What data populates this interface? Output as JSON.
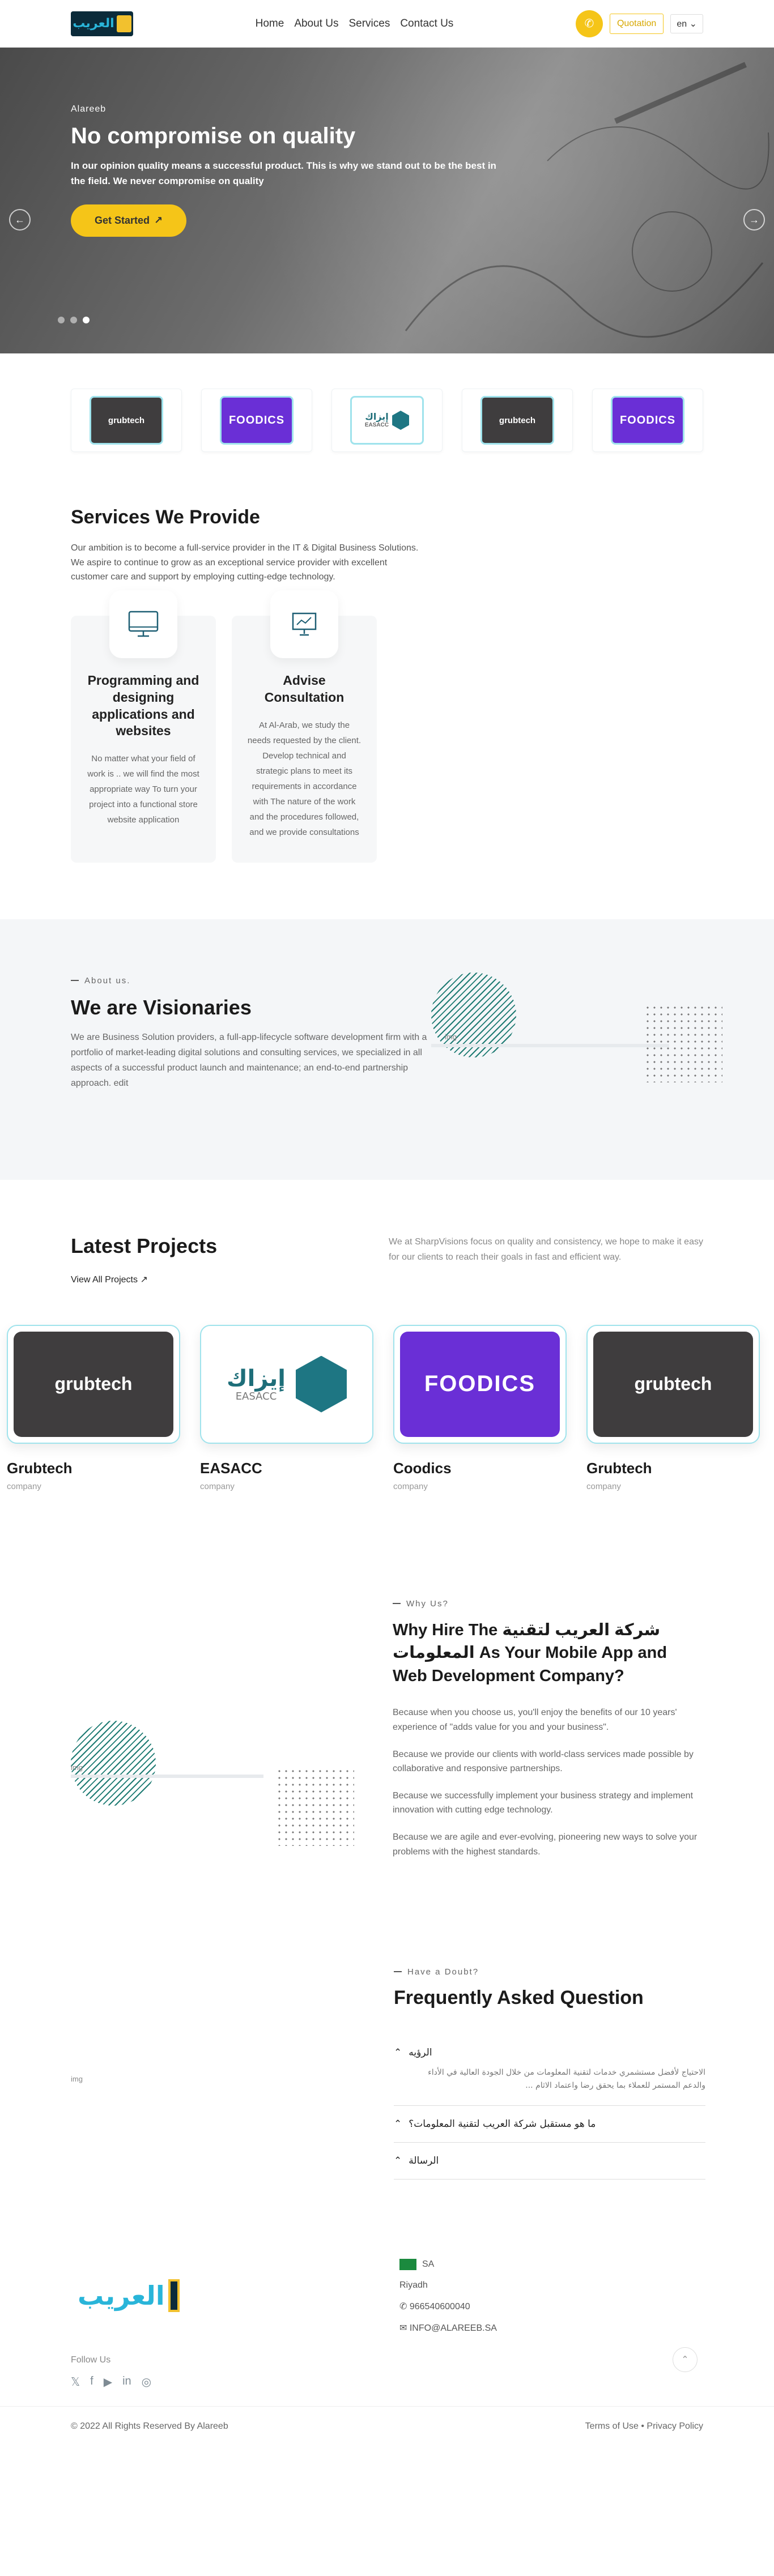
{
  "nav": {
    "logo_text": "العريب",
    "links": [
      "Home",
      "About Us",
      "Services",
      "Contact Us"
    ],
    "quote_label": "Quotation",
    "lang_label": "en"
  },
  "hero": {
    "eyebrow": "Alareeb",
    "title": "No compromise on quality",
    "text": "In our opinion quality means a successful product. This is why we stand out to be the best in the field. We never compromise on quality",
    "cta": "Get Started",
    "slide_count": 3,
    "active_slide": 3
  },
  "partners": [
    {
      "name": "grubtech",
      "style": "grub"
    },
    {
      "name": "FOODICS",
      "style": "food"
    },
    {
      "name": "إيزاك",
      "sub": "EASACC",
      "style": "esa"
    },
    {
      "name": "grubtech",
      "style": "grub"
    },
    {
      "name": "FOODICS",
      "style": "food"
    }
  ],
  "services": {
    "title": "Services We Provide",
    "desc": "Our ambition is to become a full-service provider in the IT & Digital Business Solutions. We aspire to continue to grow as an exceptional service provider with excellent customer care and support by employing cutting-edge technology.",
    "cards": [
      {
        "title": "Programming and designing applications and websites",
        "text": "No matter what your field of work is .. we will find the most appropriate way To turn your project into a functional store website application",
        "icon": "monitor-icon"
      },
      {
        "title": "Advise Consultation",
        "text": "At Al-Arab, we study the needs requested by the client. Develop technical and strategic plans to meet its requirements in accordance with The nature of the work and the procedures followed, and we provide consultations",
        "icon": "presentation-icon"
      }
    ]
  },
  "about": {
    "eyebrow": "About us.",
    "title": "We are Visionaries",
    "text": "We are Business Solution providers, a full-app-lifecycle software development firm with a portfolio of market-leading digital solutions and consulting services, we specialized in all aspects of a successful product launch and maintenance; an end-to-end partnership approach. edit",
    "img_alt": "img"
  },
  "projects": {
    "title": "Latest Projects",
    "view_all": "View All Projects",
    "desc": "We at SharpVisions focus on quality and consistency, we hope to make it easy for our clients to reach their goals in fast and efficient way.",
    "items": [
      {
        "name": "Grubtech",
        "sub": "company",
        "logo": "grubtech",
        "style": "grub"
      },
      {
        "name": "EASACC",
        "sub": "company",
        "logo": "إيزاك",
        "logo_sub": "EASACC",
        "style": "esa"
      },
      {
        "name": "Coodics",
        "sub": "company",
        "logo": "FOODICS",
        "style": "food"
      },
      {
        "name": "Grubtech",
        "sub": "company",
        "logo": "grubtech",
        "style": "grub"
      }
    ]
  },
  "why": {
    "eyebrow": "Why Us?",
    "title": "Why Hire The شركة العريب لتقنية المعلومات As Your Mobile App and Web Development Company?",
    "paras": [
      "Because when you choose us, you'll enjoy the benefits of our 10 years' experience of \"adds value for you and your business\".",
      "Because we provide our clients with world-class services made possible by collaborative and responsive partnerships.",
      "Because we successfully implement your business strategy and implement innovation with cutting edge technology.",
      "Because we are agile and ever-evolving, pioneering new ways to solve your problems with the highest standards."
    ],
    "img_alt": "img"
  },
  "faq": {
    "eyebrow": "Have a Doubt?",
    "title": "Frequently Asked Question",
    "img_alt": "img",
    "items": [
      {
        "q": "الرؤيه",
        "a": "الاحتياج لأفضل مستشمري خدمات لتقنية المعلومات من خلال الجودة العالية في الأداء والدعم المستمر للعملاء بما يحقق رضا واعتماد الاثام ..."
      },
      {
        "q": "ما هو مستقبل شركة العريب لتقنية المعلومات؟",
        "a": ""
      },
      {
        "q": "الرسالة",
        "a": ""
      }
    ]
  },
  "footer": {
    "logo_text": "العريب",
    "follow": "Follow Us",
    "country": "SA",
    "city": "Riyadh",
    "phone": "966540600040",
    "email": "INFO@ALAREEB.SA",
    "copyright": "© 2022 All Rights Reserved By Alareeb",
    "terms": "Terms of Use",
    "privacy": "Privacy Policy"
  },
  "colors": {
    "accent": "#f5c518",
    "brand_teal": "#1e7b73",
    "brand_cyan": "#29b5d9",
    "foodics_purple": "#6a2fd6"
  }
}
